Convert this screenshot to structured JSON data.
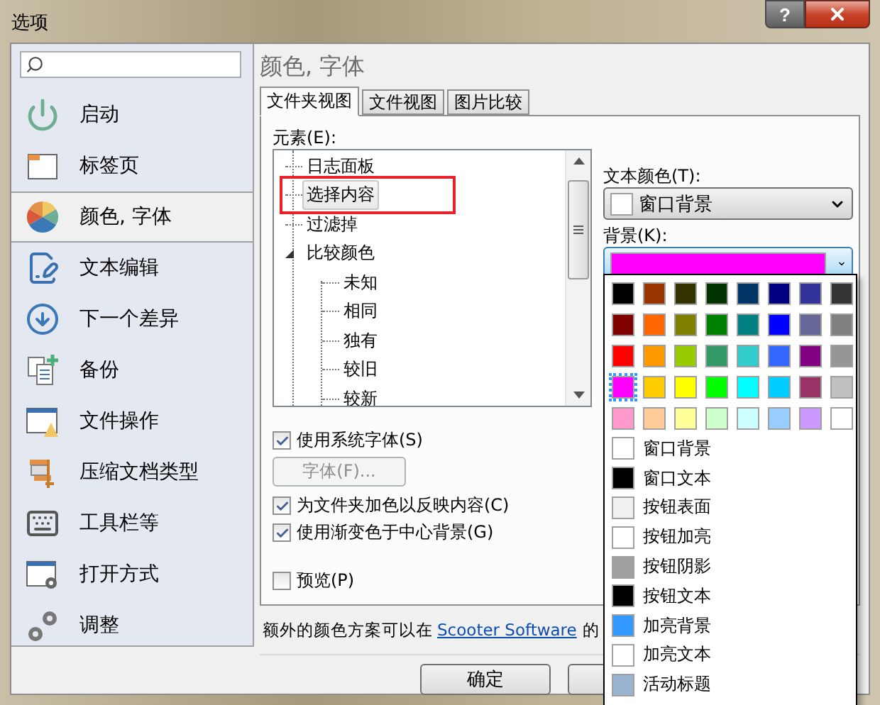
{
  "window": {
    "title": "选项",
    "help": "?"
  },
  "sidebar": {
    "items": [
      {
        "label": "启动",
        "selected": false
      },
      {
        "label": "标签页",
        "selected": false
      },
      {
        "label": "颜色, 字体",
        "selected": true
      },
      {
        "label": "文本编辑",
        "selected": false
      },
      {
        "label": "下一个差异",
        "selected": false
      },
      {
        "label": "备份",
        "selected": false
      },
      {
        "label": "文件操作",
        "selected": false
      },
      {
        "label": "压缩文档类型",
        "selected": false
      },
      {
        "label": "工具栏等",
        "selected": false
      },
      {
        "label": "打开方式",
        "selected": false
      },
      {
        "label": "调整",
        "selected": false
      }
    ]
  },
  "page": {
    "heading": "颜色, 字体",
    "tabs": [
      {
        "label": "文件夹视图",
        "selected": true
      },
      {
        "label": "文件视图",
        "selected": false
      },
      {
        "label": "图片比较",
        "selected": false
      }
    ],
    "elements_label": "元素(E):",
    "tree": [
      {
        "label": "日志面板",
        "selected": false,
        "highlighted": false
      },
      {
        "label": "选择内容",
        "selected": true,
        "highlighted": true
      },
      {
        "label": "过滤掉",
        "selected": false,
        "highlighted": false
      },
      {
        "label": "比较颜色",
        "selected": false,
        "highlighted": false,
        "expanded": true,
        "children": [
          {
            "label": "未知",
            "selected": false,
            "highlighted": false
          },
          {
            "label": "相同",
            "selected": false,
            "highlighted": false
          },
          {
            "label": "独有",
            "selected": false,
            "highlighted": false
          },
          {
            "label": "较旧",
            "selected": false,
            "highlighted": false
          },
          {
            "label": "较新",
            "selected": false,
            "highlighted": false
          }
        ]
      }
    ],
    "text_color": {
      "label": "文本颜色(T):",
      "value": "窗口背景",
      "color": "#ffffff"
    },
    "background": {
      "label": "背景(K):",
      "color": "#ff00ff",
      "expanded": true
    },
    "palette": {
      "swatches": [
        {
          "color": "#000000",
          "selected": false
        },
        {
          "color": "#993300",
          "selected": false
        },
        {
          "color": "#333300",
          "selected": false
        },
        {
          "color": "#003300",
          "selected": false
        },
        {
          "color": "#003366",
          "selected": false
        },
        {
          "color": "#000080",
          "selected": false
        },
        {
          "color": "#333399",
          "selected": false
        },
        {
          "color": "#333333",
          "selected": false
        },
        {
          "color": "#800000",
          "selected": false
        },
        {
          "color": "#ff6600",
          "selected": false
        },
        {
          "color": "#808000",
          "selected": false
        },
        {
          "color": "#008000",
          "selected": false
        },
        {
          "color": "#008080",
          "selected": false
        },
        {
          "color": "#0000ff",
          "selected": false
        },
        {
          "color": "#666699",
          "selected": false
        },
        {
          "color": "#808080",
          "selected": false
        },
        {
          "color": "#ff0000",
          "selected": false
        },
        {
          "color": "#ff9900",
          "selected": false
        },
        {
          "color": "#99cc00",
          "selected": false
        },
        {
          "color": "#339966",
          "selected": false
        },
        {
          "color": "#33cccc",
          "selected": false
        },
        {
          "color": "#3366ff",
          "selected": false
        },
        {
          "color": "#800080",
          "selected": false
        },
        {
          "color": "#969696",
          "selected": false
        },
        {
          "color": "#ff00ff",
          "selected": true
        },
        {
          "color": "#ffcc00",
          "selected": false
        },
        {
          "color": "#ffff00",
          "selected": false
        },
        {
          "color": "#00ff00",
          "selected": false
        },
        {
          "color": "#00ffff",
          "selected": false
        },
        {
          "color": "#00ccff",
          "selected": false
        },
        {
          "color": "#993366",
          "selected": false
        },
        {
          "color": "#c0c0c0",
          "selected": false
        },
        {
          "color": "#ff99cc",
          "selected": false
        },
        {
          "color": "#ffcc99",
          "selected": false
        },
        {
          "color": "#ffff99",
          "selected": false
        },
        {
          "color": "#ccffcc",
          "selected": false
        },
        {
          "color": "#ccffff",
          "selected": false
        },
        {
          "color": "#99ccff",
          "selected": false
        },
        {
          "color": "#cc99ff",
          "selected": false
        },
        {
          "color": "#ffffff",
          "selected": false
        }
      ],
      "system_colors": [
        {
          "label": "窗口背景",
          "color": "#ffffff"
        },
        {
          "label": "窗口文本",
          "color": "#000000"
        },
        {
          "label": "按钮表面",
          "color": "#f0f0f0"
        },
        {
          "label": "按钮加亮",
          "color": "#ffffff"
        },
        {
          "label": "按钮阴影",
          "color": "#a0a0a0"
        },
        {
          "label": "按钮文本",
          "color": "#000000"
        },
        {
          "label": "加亮背景",
          "color": "#3399ff"
        },
        {
          "label": "加亮文本",
          "color": "#ffffff"
        },
        {
          "label": "活动标题",
          "color": "#99b4d1"
        }
      ]
    },
    "options": [
      {
        "kind": "checkbox",
        "label": "使用系统字体(S)",
        "checked": true
      },
      {
        "kind": "button",
        "label": "字体(F)...",
        "disabled": true
      },
      {
        "kind": "checkbox",
        "label": "为文件夹加色以反映内容(C)",
        "checked": true
      },
      {
        "kind": "checkbox",
        "label": "使用渐变色于中心背景(G)",
        "checked": true
      },
      {
        "kind": "spacer"
      },
      {
        "kind": "checkbox",
        "label": "预览(P)",
        "checked": false
      }
    ],
    "footer": {
      "text": "额外的颜色方案可以在",
      "link": "Scooter Software",
      "tail": "的"
    },
    "buttons": [
      "确定"
    ]
  }
}
